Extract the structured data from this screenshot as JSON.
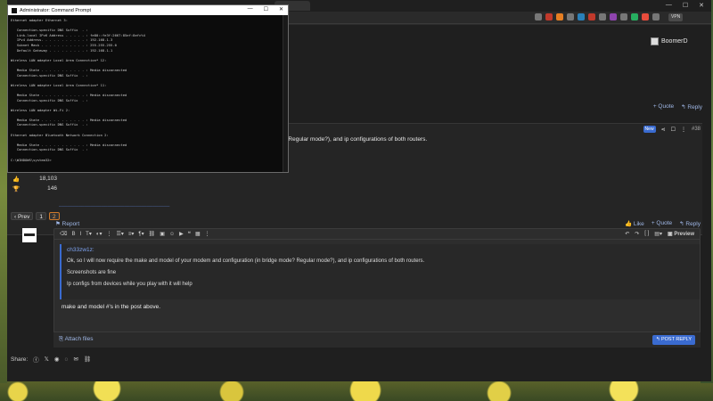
{
  "cmd": {
    "title": "Administrator: Command Prompt",
    "controls": [
      "—",
      "☐",
      "✕"
    ],
    "lines": [
      "Ethernet adapter Ethernet 3:",
      "",
      "   Connection-specific DNS Suffix  . :",
      "   Link-local IPv6 Address . . . . . : fe80::fe3f:2667:85ef:8efc%4",
      "   IPv4 Address. . . . . . . . . . . : 192.168.1.3",
      "   Subnet Mask . . . . . . . . . . . : 255.255.255.0",
      "   Default Gateway . . . . . . . . . : 192.168.1.1",
      "",
      "Wireless LAN adapter Local Area Connection* 12:",
      "",
      "   Media State . . . . . . . . . . . : Media disconnected",
      "   Connection-specific DNS Suffix  . :",
      "",
      "Wireless LAN adapter Local Area Connection* 11:",
      "",
      "   Media State . . . . . . . . . . . : Media disconnected",
      "   Connection-specific DNS Suffix  . :",
      "",
      "Wireless LAN adapter Wi-Fi 2:",
      "",
      "   Media State . . . . . . . . . . . : Media disconnected",
      "   Connection-specific DNS Suffix  . :",
      "",
      "Ethernet adapter Bluetooth Network Connection 2:",
      "",
      "   Media State . . . . . . . . . . . : Media disconnected",
      "   Connection-specific DNS Suffix  . :",
      "",
      "C:\\WINDOWS\\system32>"
    ]
  },
  "browser": {
    "vpn_label": "VPN"
  },
  "user": {
    "name": "BoomerD"
  },
  "post1": {
    "quote_label": "+ Quote",
    "reply_label": "↰ Reply"
  },
  "post2": {
    "badge": "New",
    "number": "#38",
    "body_partial": "? Regular mode?), and ip configurations of both routers.",
    "stat1": "18,103",
    "stat2": "146",
    "report_label": "Report",
    "like_label": "Like",
    "quote_label": "+ Quote",
    "reply_label": "↰ Reply"
  },
  "pager": {
    "prev": "‹ Prev",
    "p1": "1",
    "p2": "2"
  },
  "editor": {
    "preview_label": "Preview",
    "quote_author": "ch33zw1z:",
    "quote_lines": [
      "Ok, so I will now require the make and model of your modem and configuration (in bridge mode? Regular mode?), and ip configurations of both routers.",
      "Screenshots are fine",
      "Ip configs from devices while you play with it will help"
    ],
    "reply_text": "make and model #'s  in the post above.",
    "attach_label": "Attach files",
    "post_reply_label": "POST REPLY"
  },
  "share": {
    "label": "Share:"
  }
}
